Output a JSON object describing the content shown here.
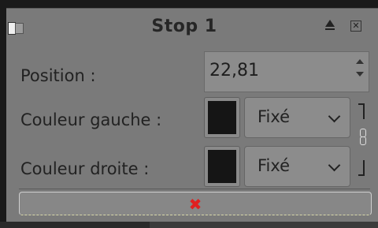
{
  "dialog": {
    "title": "Stop 1",
    "icons": [
      "grip-icon",
      "raise-icon",
      "close-icon"
    ]
  },
  "fields": {
    "position_label": "Position :",
    "position_value": "22,81",
    "left_color_label": "Couleur gauche :",
    "right_color_label": "Couleur droite :",
    "left_color_hex": "#151515",
    "right_color_hex": "#151515",
    "left_mode": "Fixé",
    "right_mode": "Fixé"
  },
  "actions": {
    "delete_symbol": "✖",
    "delete_color": "#e02020"
  },
  "colors": {
    "panel_bg": "#7a7a7a",
    "text": "#222222"
  }
}
